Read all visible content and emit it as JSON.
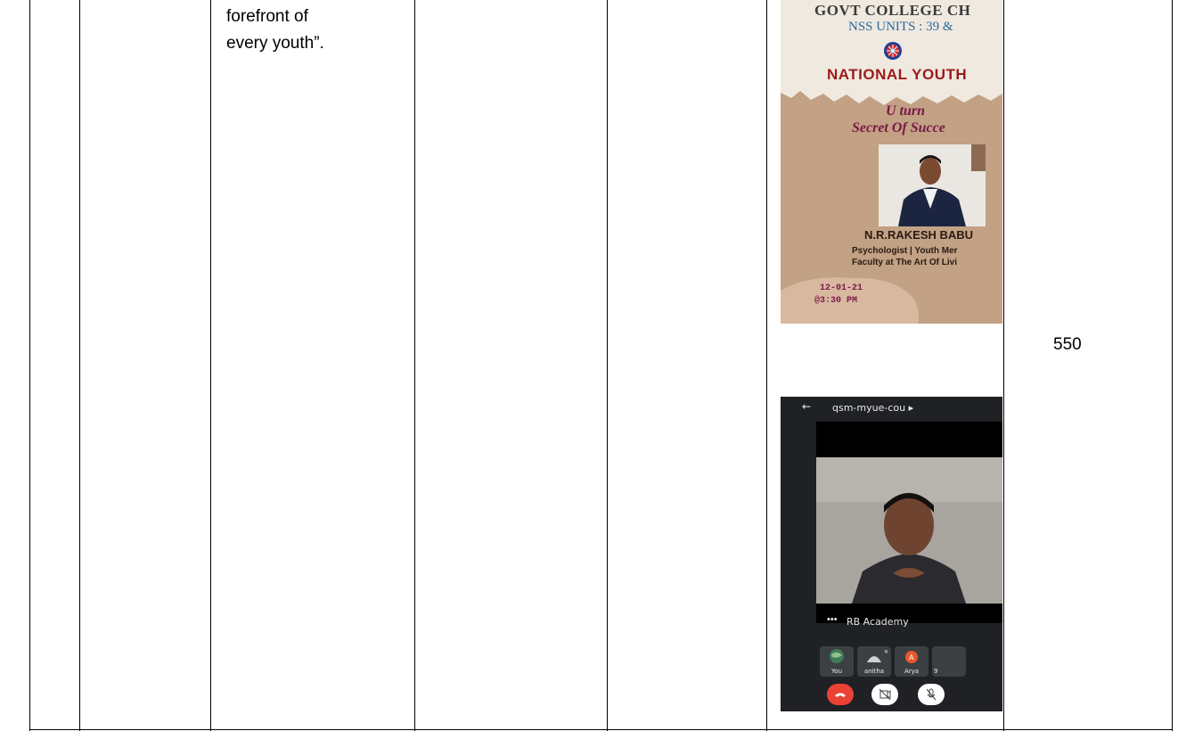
{
  "table": {
    "col3_text_line1": "forefront of",
    "col3_text_line2": "every youth”.",
    "count": "550"
  },
  "poster": {
    "college": "GOVT COLLEGE CH",
    "nss_units": "NSS UNITS : 39 &",
    "event": "NATIONAL YOUTH",
    "topic_line1": "U turn",
    "topic_line2": "Secret Of Succe",
    "speaker_name": "N.R.RAKESH BABU",
    "speaker_role_line1": "Psychologist | Youth Mer",
    "speaker_role_line2": "Faculty at The Art Of Livi",
    "date": "12-01-21",
    "time": "@3:30 PM"
  },
  "meet": {
    "back_icon": "arrow-left-icon",
    "meeting_code": "qsm-myue-cou ▸",
    "speaker_tile_name": "RB Academy",
    "participants": [
      {
        "label": "You"
      },
      {
        "label": "anitha"
      },
      {
        "label": "Arya"
      },
      {
        "label": "9"
      }
    ],
    "arya_initial": "A",
    "colors": {
      "end_call": "#ea4335",
      "background": "#202124",
      "avatar_orange": "#e8572b"
    }
  }
}
